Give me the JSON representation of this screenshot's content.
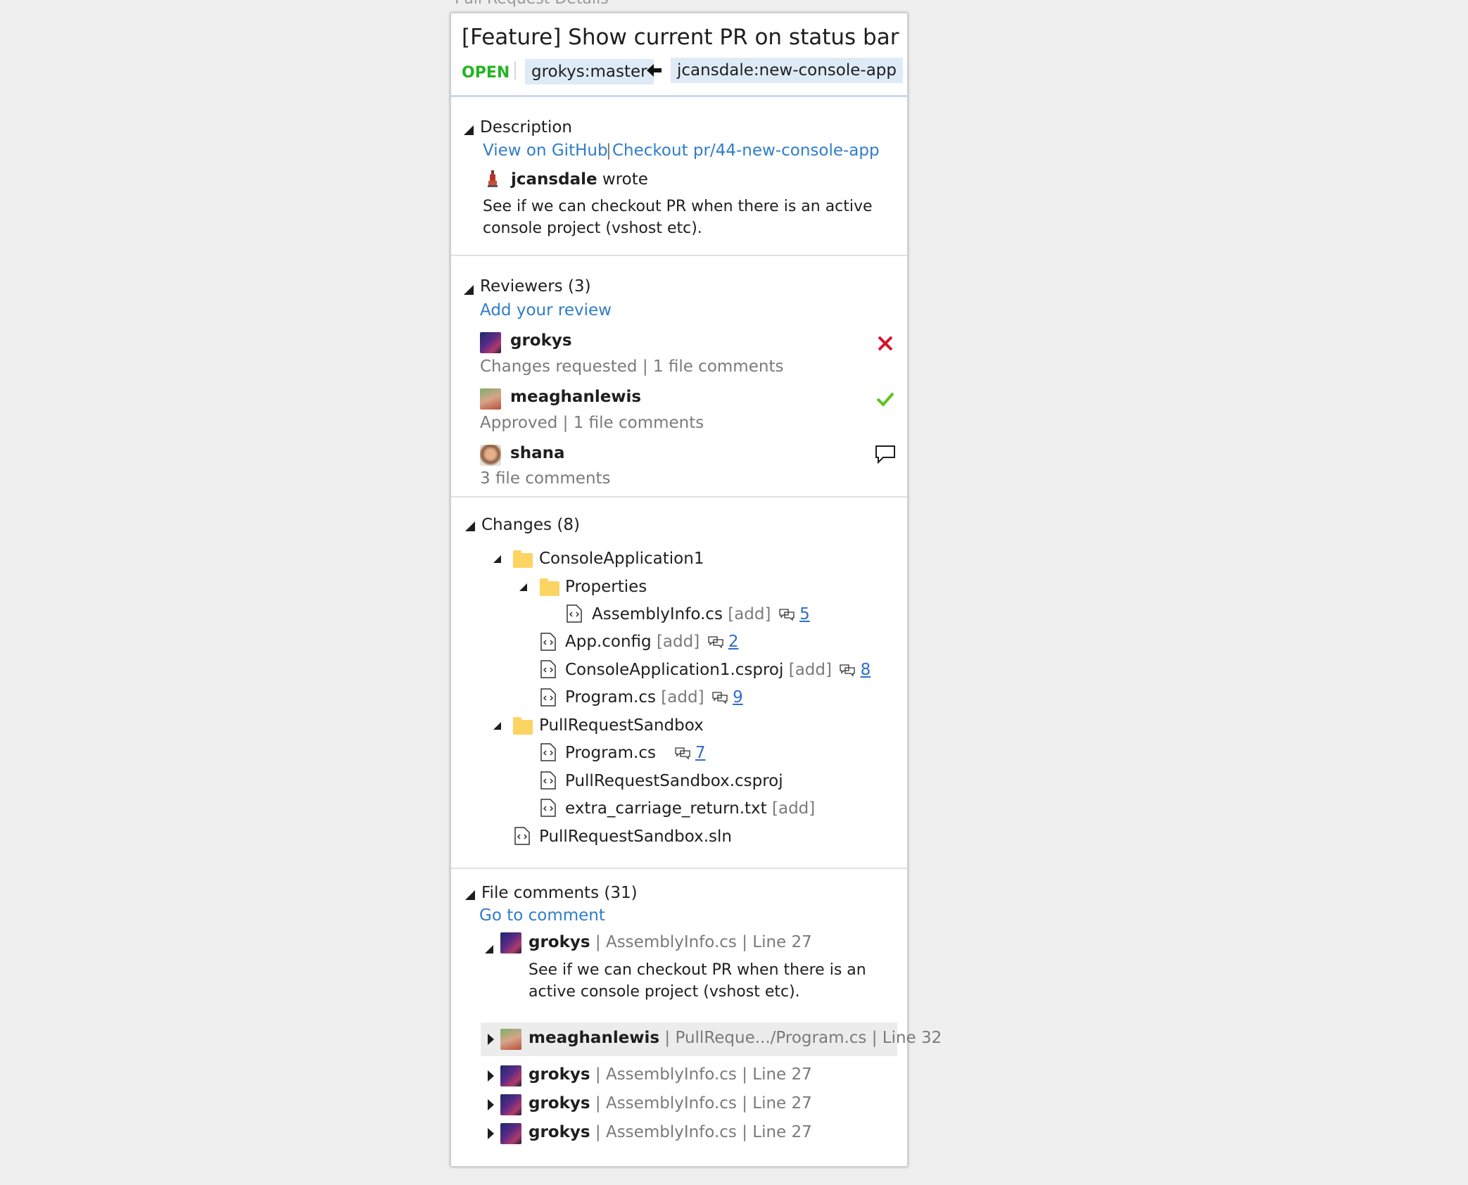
{
  "window": {
    "title": "Pull Request Details"
  },
  "header": {
    "title": "[Feature] Show current PR on status bar",
    "state": "OPEN",
    "target_branch": "grokys:master",
    "source_branch": "jcansdale:new-console-app"
  },
  "description": {
    "heading": "Description",
    "view_link": "View on GitHub",
    "separator": "|",
    "checkout_link": "Checkout pr/44-new-console-app",
    "author": "jcansdale",
    "wrote": "wrote",
    "body_line1": "See if we can checkout PR when there is an active",
    "body_line2": "console project (vshost etc)."
  },
  "reviewers": {
    "heading": "Reviewers (3)",
    "add_review": "Add your review",
    "items": [
      {
        "name": "grokys",
        "summary": "Changes requested | 1 file comments",
        "status_icon": "x-icon"
      },
      {
        "name": "meaghanlewis",
        "summary": "Approved | 1 file comments",
        "status_icon": "check-icon"
      },
      {
        "name": "shana",
        "summary": "3 file comments",
        "status_icon": "comment-icon"
      }
    ]
  },
  "changes": {
    "heading": "Changes (8)",
    "tree": [
      {
        "name": "ConsoleApplication1",
        "type": "folder"
      },
      {
        "name": "Properties",
        "type": "folder"
      },
      {
        "name": "AssemblyInfo.cs",
        "tag": "[add]",
        "comments": "5"
      },
      {
        "name": "App.config",
        "tag": "[add]",
        "comments": "2"
      },
      {
        "name": "ConsoleApplication1.csproj",
        "tag": "[add]",
        "comments": "8"
      },
      {
        "name": "Program.cs",
        "tag": "[add]",
        "comments": "9"
      },
      {
        "name": "PullRequestSandbox",
        "type": "folder"
      },
      {
        "name": "Program.cs",
        "tag": "",
        "comments": "7"
      },
      {
        "name": "PullRequestSandbox.csproj",
        "tag": "",
        "comments": ""
      },
      {
        "name": "extra_carriage_return.txt",
        "tag": "[add]",
        "comments": ""
      },
      {
        "name": "PullRequestSandbox.sln",
        "tag": "",
        "comments": ""
      }
    ]
  },
  "file_comments": {
    "heading": "File comments (31)",
    "goto": "Go to comment",
    "items": [
      {
        "author": "grokys",
        "location": " | AssemblyInfo.cs | Line 27",
        "body_line1": "See if we can checkout PR when there is an",
        "body_line2": "active console project (vshost etc)."
      },
      {
        "author": "meaghanlewis",
        "location": " | PullReque.../Program.cs | Line 32"
      },
      {
        "author": "grokys",
        "location": " | AssemblyInfo.cs | Line 27"
      },
      {
        "author": "grokys",
        "location": " | AssemblyInfo.cs | Line 27"
      },
      {
        "author": "grokys",
        "location": " | AssemblyInfo.cs | Line 27"
      }
    ]
  },
  "colors": {
    "open_state": "#22b522",
    "link": "#2f7dc8",
    "branch_bg": "#deebf7",
    "reject": "#d9112a",
    "approve": "#5cc21f"
  }
}
